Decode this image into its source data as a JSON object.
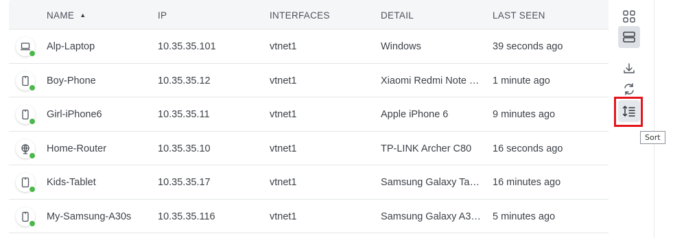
{
  "table": {
    "columns": {
      "name": "NAME",
      "ip": "IP",
      "interfaces": "INTERFACES",
      "detail": "DETAIL",
      "last_seen": "LAST SEEN"
    },
    "sort_indicator": "▲",
    "rows": [
      {
        "icon": "laptop-icon",
        "name": "Alp-Laptop",
        "ip": "10.35.35.101",
        "interface": "vtnet1",
        "detail": "Windows",
        "last_seen": "39 seconds ago"
      },
      {
        "icon": "phone-icon",
        "name": "Boy-Phone",
        "ip": "10.35.35.12",
        "interface": "vtnet1",
        "detail": "Xiaomi Redmi Note …",
        "last_seen": "1 minute ago"
      },
      {
        "icon": "phone-icon",
        "name": "Girl-iPhone6",
        "ip": "10.35.35.11",
        "interface": "vtnet1",
        "detail": "Apple iPhone 6",
        "last_seen": "9 minutes ago"
      },
      {
        "icon": "router-icon",
        "name": "Home-Router",
        "ip": "10.35.35.10",
        "interface": "vtnet1",
        "detail": "TP-LINK Archer C80",
        "last_seen": "16 seconds ago"
      },
      {
        "icon": "tablet-icon",
        "name": "Kids-Tablet",
        "ip": "10.35.35.17",
        "interface": "vtnet1",
        "detail": "Samsung Galaxy Ta…",
        "last_seen": "16 minutes ago"
      },
      {
        "icon": "phone-icon",
        "name": "My-Samsung-A30s",
        "ip": "10.35.35.116",
        "interface": "vtnet1",
        "detail": "Samsung Galaxy A3…",
        "last_seen": "5 minutes ago"
      }
    ]
  },
  "toolbar": {
    "buttons": [
      "grid-view-icon",
      "list-view-icon",
      "download-icon",
      "refresh-icon",
      "sort-icon"
    ],
    "tooltip": "Sort"
  },
  "colors": {
    "status_online": "#4cb84c",
    "highlight": "#e3141b"
  }
}
